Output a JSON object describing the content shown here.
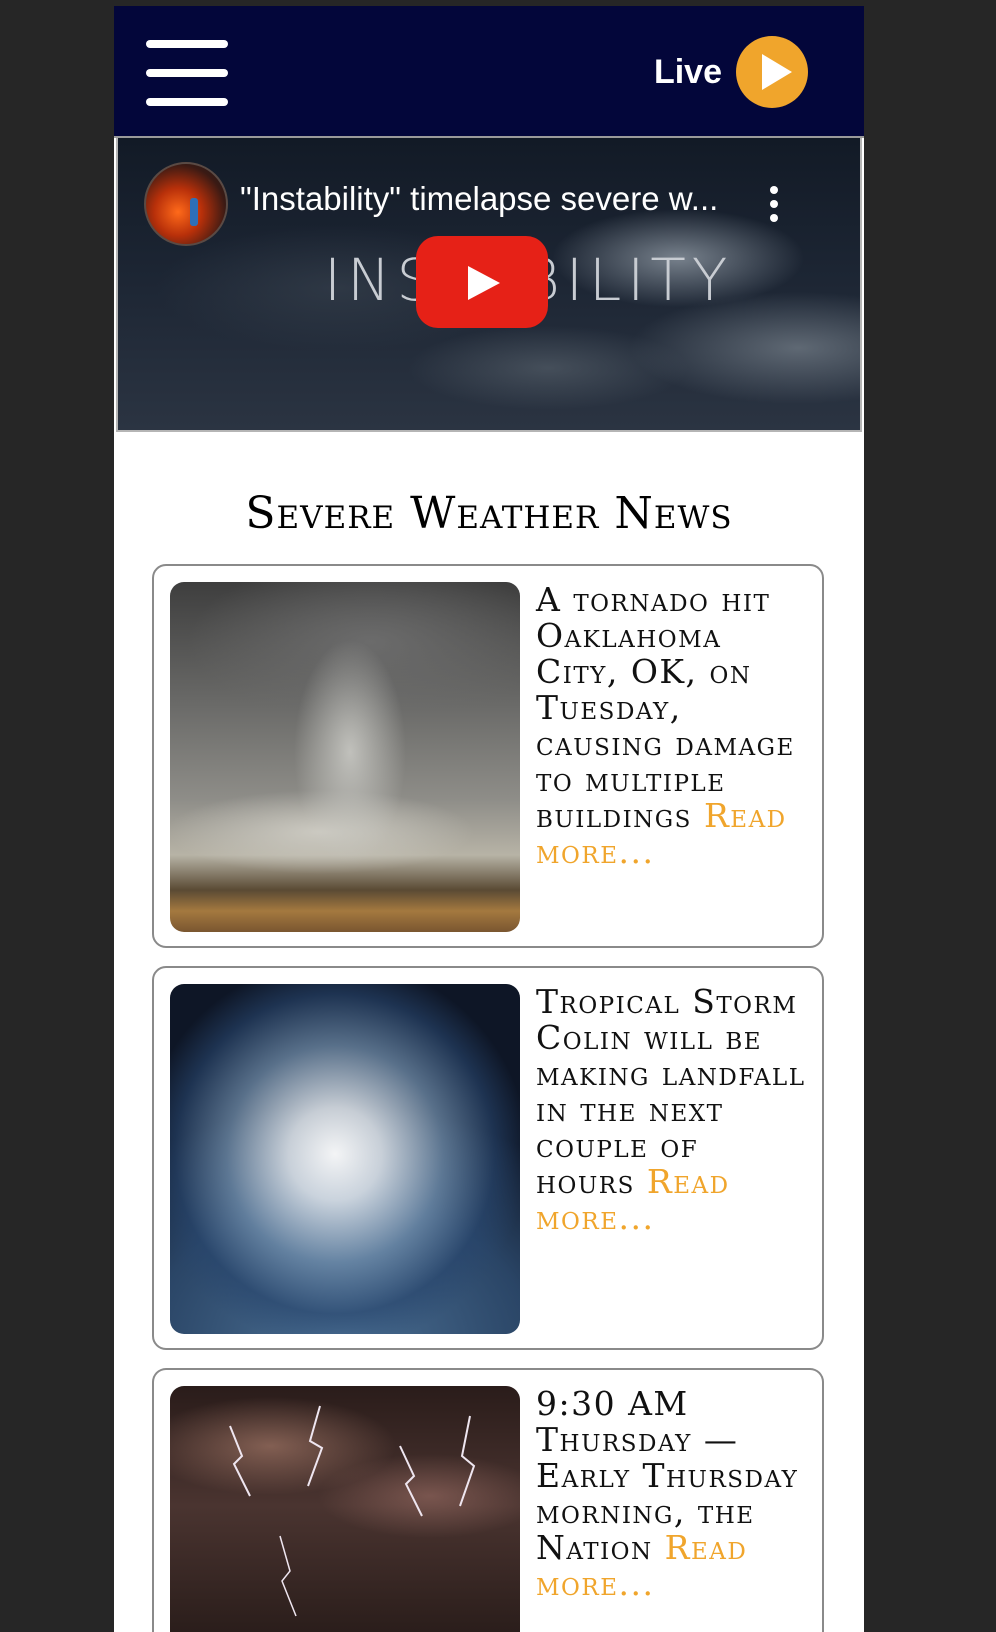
{
  "header": {
    "menu_icon": "hamburger-menu-icon",
    "live_label": "Live",
    "live_icon": "play-icon",
    "background_color": "#03063a",
    "accent_color": "#f0a52c"
  },
  "video": {
    "title": "\"Instability\" timelapse severe w...",
    "wordmark": "INSTABILITY",
    "play_icon": "youtube-play-icon",
    "more_icon": "kebab-menu-icon"
  },
  "section": {
    "heading": "Severe Weather News"
  },
  "articles": [
    {
      "text": "A tornado hit Oaklahoma City, OK, on Tuesday, causing damage to multiple buildings",
      "read_more": "Read more...",
      "image": "supercell-storm-photo"
    },
    {
      "text": "Tropical Storm Colin will be making landfall in the next couple of hours",
      "read_more": "Read more...",
      "image": "hurricane-satellite-photo"
    },
    {
      "text": "9:30 AM Thursday — Early Thursday morning, the Nation",
      "read_more": "Read more...",
      "image": "lightning-storm-photo"
    }
  ]
}
